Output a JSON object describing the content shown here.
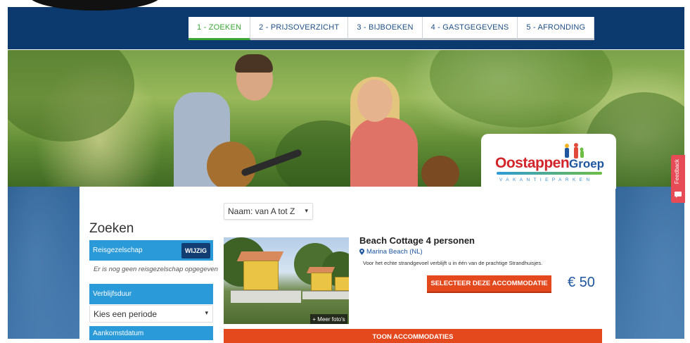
{
  "steps": [
    {
      "label": "1 - ZOEKEN",
      "active": true
    },
    {
      "label": "2 - PRIJSOVERZICHT",
      "active": false
    },
    {
      "label": "3 - BIJBOEKEN",
      "active": false
    },
    {
      "label": "4 - GASTGEGEVENS",
      "active": false
    },
    {
      "label": "5 - AFRONDING",
      "active": false
    }
  ],
  "logo": {
    "main": "Oostappen",
    "groep": "Groep",
    "sub": "VAKANTIEPARKEN"
  },
  "sort": {
    "value": "Naam: van A tot Z"
  },
  "sidebar": {
    "title": "Zoeken",
    "group_label": "Reisgezelschap",
    "edit_label": "WIJZIG",
    "no_group_text": "Er is nog geen reisgezelschap opgegeven",
    "duration_label": "Verblijfsduur",
    "period_value": "Kies een periode",
    "arrival_label": "Aankomstdatum"
  },
  "accommodation": {
    "title": "Beach Cottage 4 personen",
    "location": "Marina Beach (NL)",
    "description": "Voor het echte strandgevoel verblijft u in één van de prachtige Strandhuisjes.",
    "select_label": "SELECTEER DEZE ACCOMMODATIE",
    "price": "€ 50",
    "more_photos": "+ Meer foto's"
  },
  "show_button": "TOON ACCOMMODATIES",
  "feedback": "Feedback",
  "colors": {
    "header_blue": "#0c3a6e",
    "accent_green": "#3aa635",
    "sidebar_blue": "#2a9ad8",
    "cta_orange": "#e4481d",
    "price_blue": "#1e56a0",
    "feedback_red": "#e64b56"
  }
}
